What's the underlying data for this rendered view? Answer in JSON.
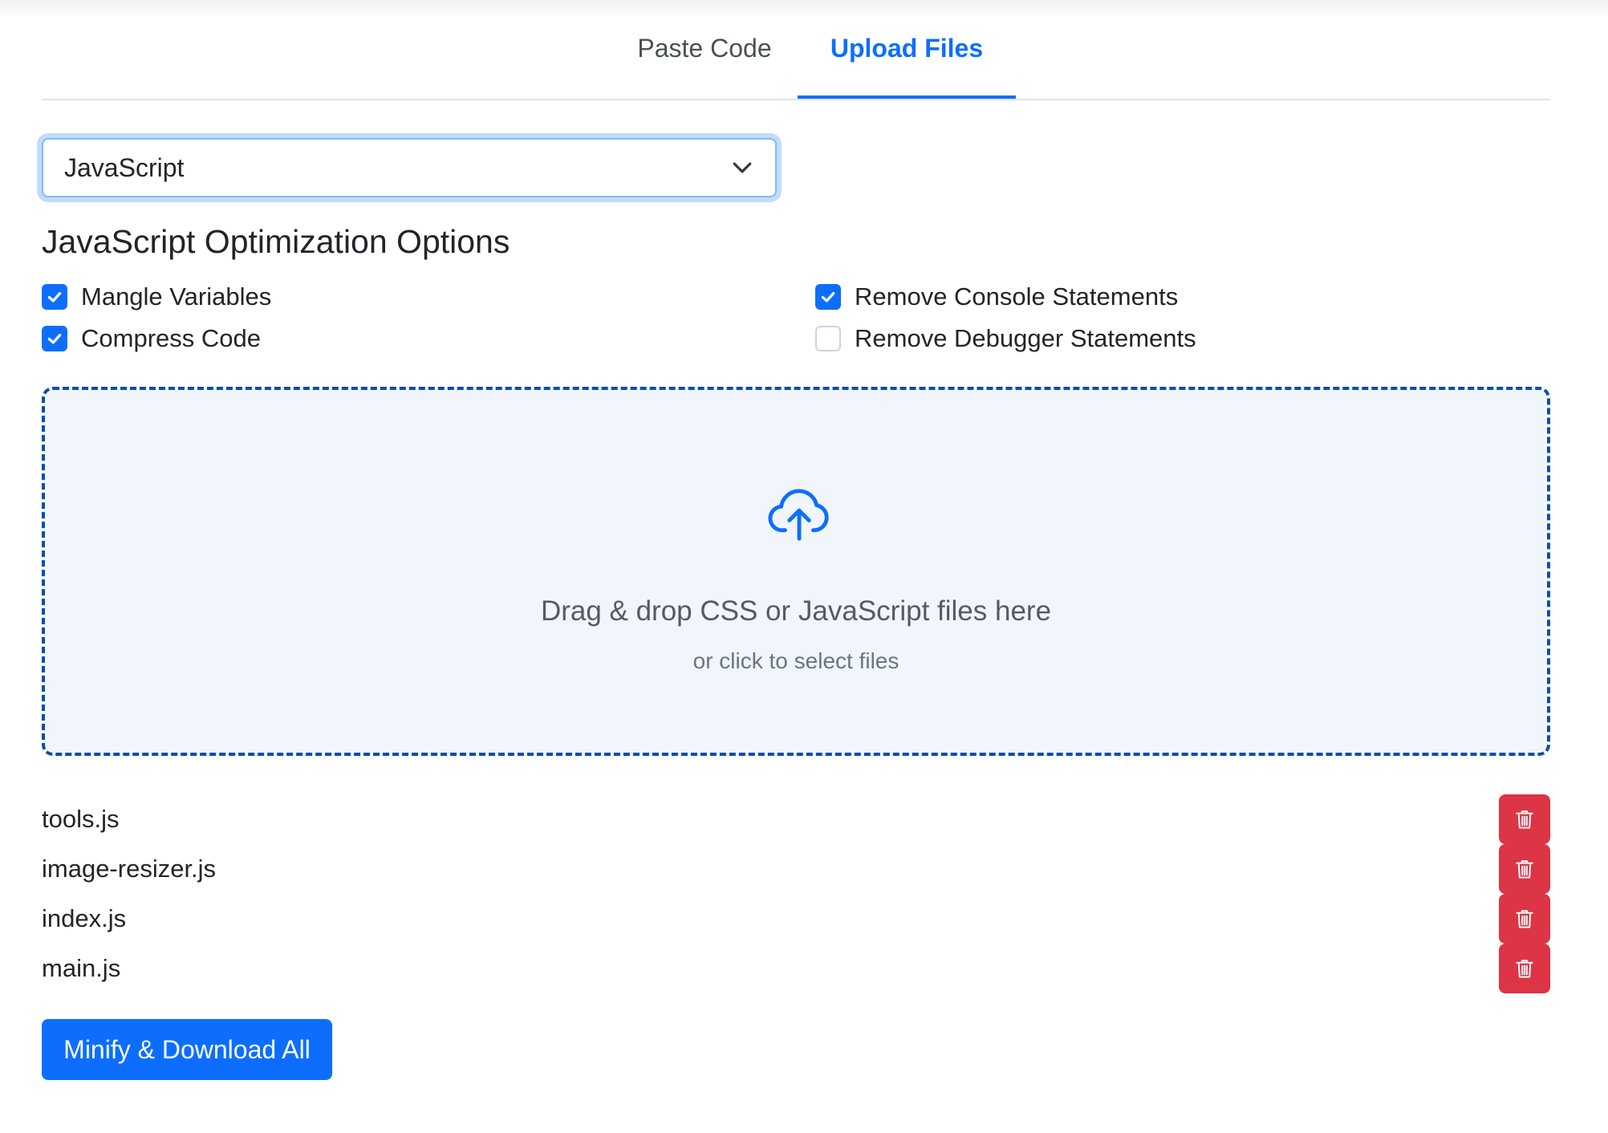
{
  "tabs": [
    {
      "label": "Paste Code",
      "active": false
    },
    {
      "label": "Upload Files",
      "active": true
    }
  ],
  "language_select": {
    "value": "JavaScript",
    "icon": "chevron-down-icon"
  },
  "options": {
    "heading": "JavaScript Optimization Options",
    "items": [
      {
        "label": "Mangle Variables",
        "checked": true
      },
      {
        "label": "Remove Console Statements",
        "checked": true
      },
      {
        "label": "Compress Code",
        "checked": true
      },
      {
        "label": "Remove Debugger Statements",
        "checked": false
      }
    ]
  },
  "dropzone": {
    "icon": "cloud-upload-icon",
    "title": "Drag & drop CSS or JavaScript files here",
    "subtitle": "or click to select files"
  },
  "files": [
    {
      "name": "tools.js"
    },
    {
      "name": "image-resizer.js"
    },
    {
      "name": "index.js"
    },
    {
      "name": "main.js"
    }
  ],
  "actions": {
    "minify_label": "Minify & Download All",
    "delete_icon": "trash-icon"
  },
  "colors": {
    "primary": "#0d6efd",
    "danger": "#dc3545",
    "dropzone_border": "#0b4ea8",
    "dropzone_bg": "#f1f6fc"
  }
}
